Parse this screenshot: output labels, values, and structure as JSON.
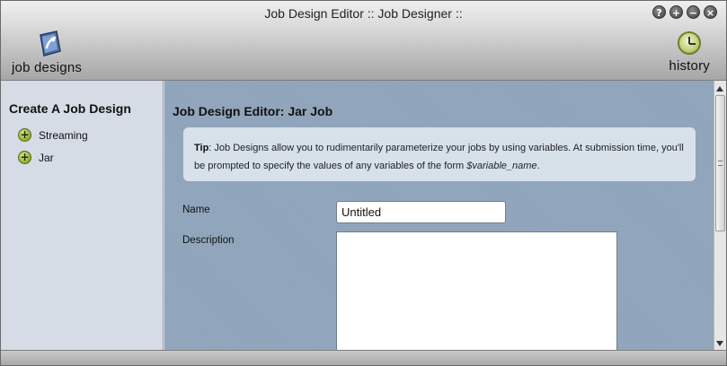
{
  "window": {
    "title": "Job Design Editor :: Job Designer ::",
    "controls": [
      "?",
      "+",
      "−",
      "×"
    ]
  },
  "toolbar": {
    "job_designs_label": "job designs",
    "history_label": "history"
  },
  "sidebar": {
    "title": "Create A Job Design",
    "items": [
      {
        "label": "Streaming",
        "icon": "plus-circle-icon"
      },
      {
        "label": "Jar",
        "icon": "plus-circle-icon"
      }
    ]
  },
  "main": {
    "title": "Job Design Editor: Jar Job",
    "tip": {
      "prefix": "Tip",
      "text1": ": Job Designs allow you to rudimentarily parameterize your jobs by using variables. At submission time, you'll be prompted to specify the values of any variables of the form ",
      "variable": "$variable_name",
      "text2": "."
    },
    "fields": {
      "name_label": "Name",
      "name_value": "Untitled",
      "description_label": "Description",
      "description_value": ""
    }
  },
  "colors": {
    "main_bg": "#8fa4bb",
    "sidebar_bg": "#d5dce6",
    "tip_bg": "#d6e1ea",
    "accent_green": "#8aa62a"
  }
}
